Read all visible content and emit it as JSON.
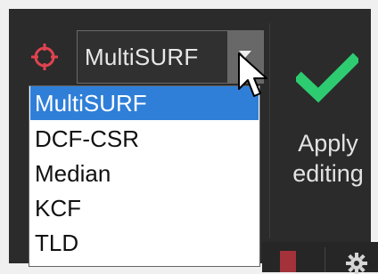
{
  "tracker": {
    "selected": "MultiSURF",
    "options": [
      "MultiSURF",
      "DCF-CSR",
      "Median",
      "KCF",
      "TLD"
    ]
  },
  "apply": {
    "label": "Apply\nediting"
  },
  "icons": {
    "tracker": "crosshair-target-icon",
    "dropdown": "chevron-down-icon",
    "apply": "checkmark-icon",
    "cursor": "mouse-pointer-icon",
    "stop": "stop-icon",
    "settings": "gear-icon"
  },
  "colors": {
    "toolbar_bg": "#2b2b2b",
    "selection": "#2f7fd8",
    "checkmark": "#2ecc71",
    "tracker_icon": "#e0434f"
  }
}
